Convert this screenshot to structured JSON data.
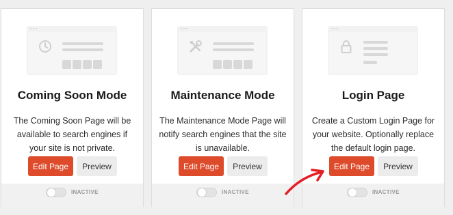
{
  "colors": {
    "accent": "#dd4b2b",
    "annotation_arrow": "#e31e24"
  },
  "cards": [
    {
      "icon": "clock-icon",
      "title": "Coming Soon Mode",
      "description": "The Coming Soon Page will be available to search engines if your site is not private.",
      "edit_label": "Edit Page",
      "preview_label": "Preview",
      "status": "INACTIVE"
    },
    {
      "icon": "tools-icon",
      "title": "Maintenance Mode",
      "description": "The Maintenance Mode Page will notify search engines that the site is unavailable.",
      "edit_label": "Edit Page",
      "preview_label": "Preview",
      "status": "INACTIVE"
    },
    {
      "icon": "lock-icon",
      "title": "Login Page",
      "description": "Create a Custom Login Page for your website. Optionally replace the default login page.",
      "edit_label": "Edit Page",
      "preview_label": "Preview",
      "status": "INACTIVE"
    }
  ]
}
